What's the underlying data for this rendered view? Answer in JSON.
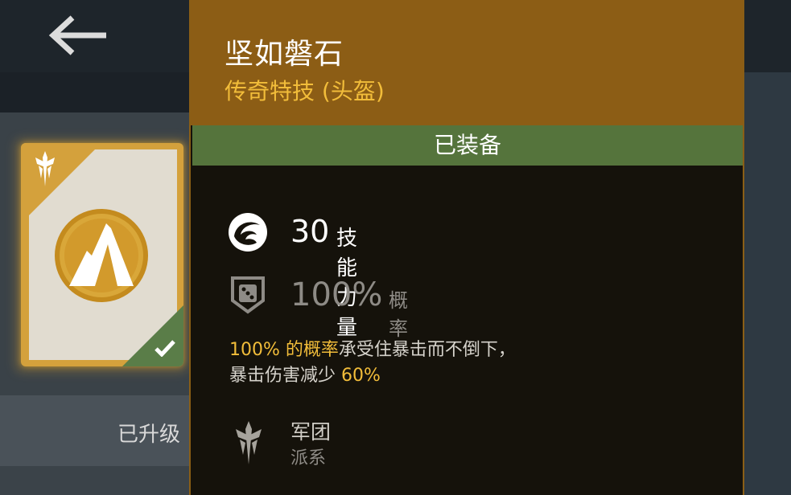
{
  "skill": {
    "name": "坚如磐石",
    "type": "传奇特技 (头盔)",
    "status": "已装备"
  },
  "stats": [
    {
      "icon": "skill-power-icon",
      "value": "30",
      "label": "技能力量"
    },
    {
      "icon": "chance-dice-icon",
      "value": "100%",
      "label": "概率"
    }
  ],
  "description": {
    "line1_pct": "100%",
    "line1_hl": " 的概率",
    "line1_rest": "承受住暴击而不倒下，",
    "line2_text": "暴击伤害减少 ",
    "line2_pct": "60%"
  },
  "faction": {
    "name": "军团",
    "label": "派系",
    "icon": "legion-crest-icon"
  },
  "left": {
    "upgraded_label": "已升级"
  },
  "icons": {
    "back": "back-arrow-icon",
    "equipped_check": "checkmark-icon"
  },
  "colors": {
    "header": "#8c5d15",
    "accent_gold": "#f2bd3a",
    "equipped_green": "#55743c",
    "panel_bg": "#15120b"
  }
}
